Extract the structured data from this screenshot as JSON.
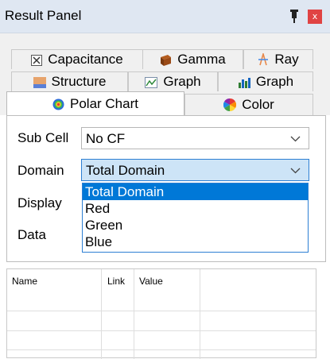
{
  "window": {
    "title": "Result Panel",
    "pin_icon": "pin-icon",
    "close_label": "x"
  },
  "tabs": {
    "row1": [
      {
        "label": "Capacitance",
        "icon": "capacitance-icon"
      },
      {
        "label": "Gamma",
        "icon": "gamma-icon"
      },
      {
        "label": "Ray",
        "icon": "ray-icon"
      }
    ],
    "row2": [
      {
        "label": "Structure",
        "icon": "structure-icon"
      },
      {
        "label": "Graph",
        "icon": "line-graph-icon"
      },
      {
        "label": "Graph",
        "icon": "bar-graph-icon"
      }
    ],
    "row3": [
      {
        "label": "Polar Chart",
        "icon": "polar-chart-icon",
        "active": true
      },
      {
        "label": "Color",
        "icon": "color-wheel-icon"
      }
    ]
  },
  "form": {
    "subcell": {
      "label": "Sub Cell",
      "value": "No CF"
    },
    "domain": {
      "label": "Domain",
      "value": "Total Domain"
    },
    "display": {
      "label": "Display"
    },
    "data": {
      "label": "Data"
    }
  },
  "domain_options": [
    "Total Domain",
    "Red",
    "Green",
    "Blue"
  ],
  "domain_selected": "Total Domain",
  "grid": {
    "columns": [
      "Name",
      "Link",
      "Value"
    ]
  },
  "colors": {
    "selection": "#0078d7",
    "combo_open_bg": "#cde4f7",
    "title_bg": "#dfe7f2",
    "close": "#e04343"
  }
}
